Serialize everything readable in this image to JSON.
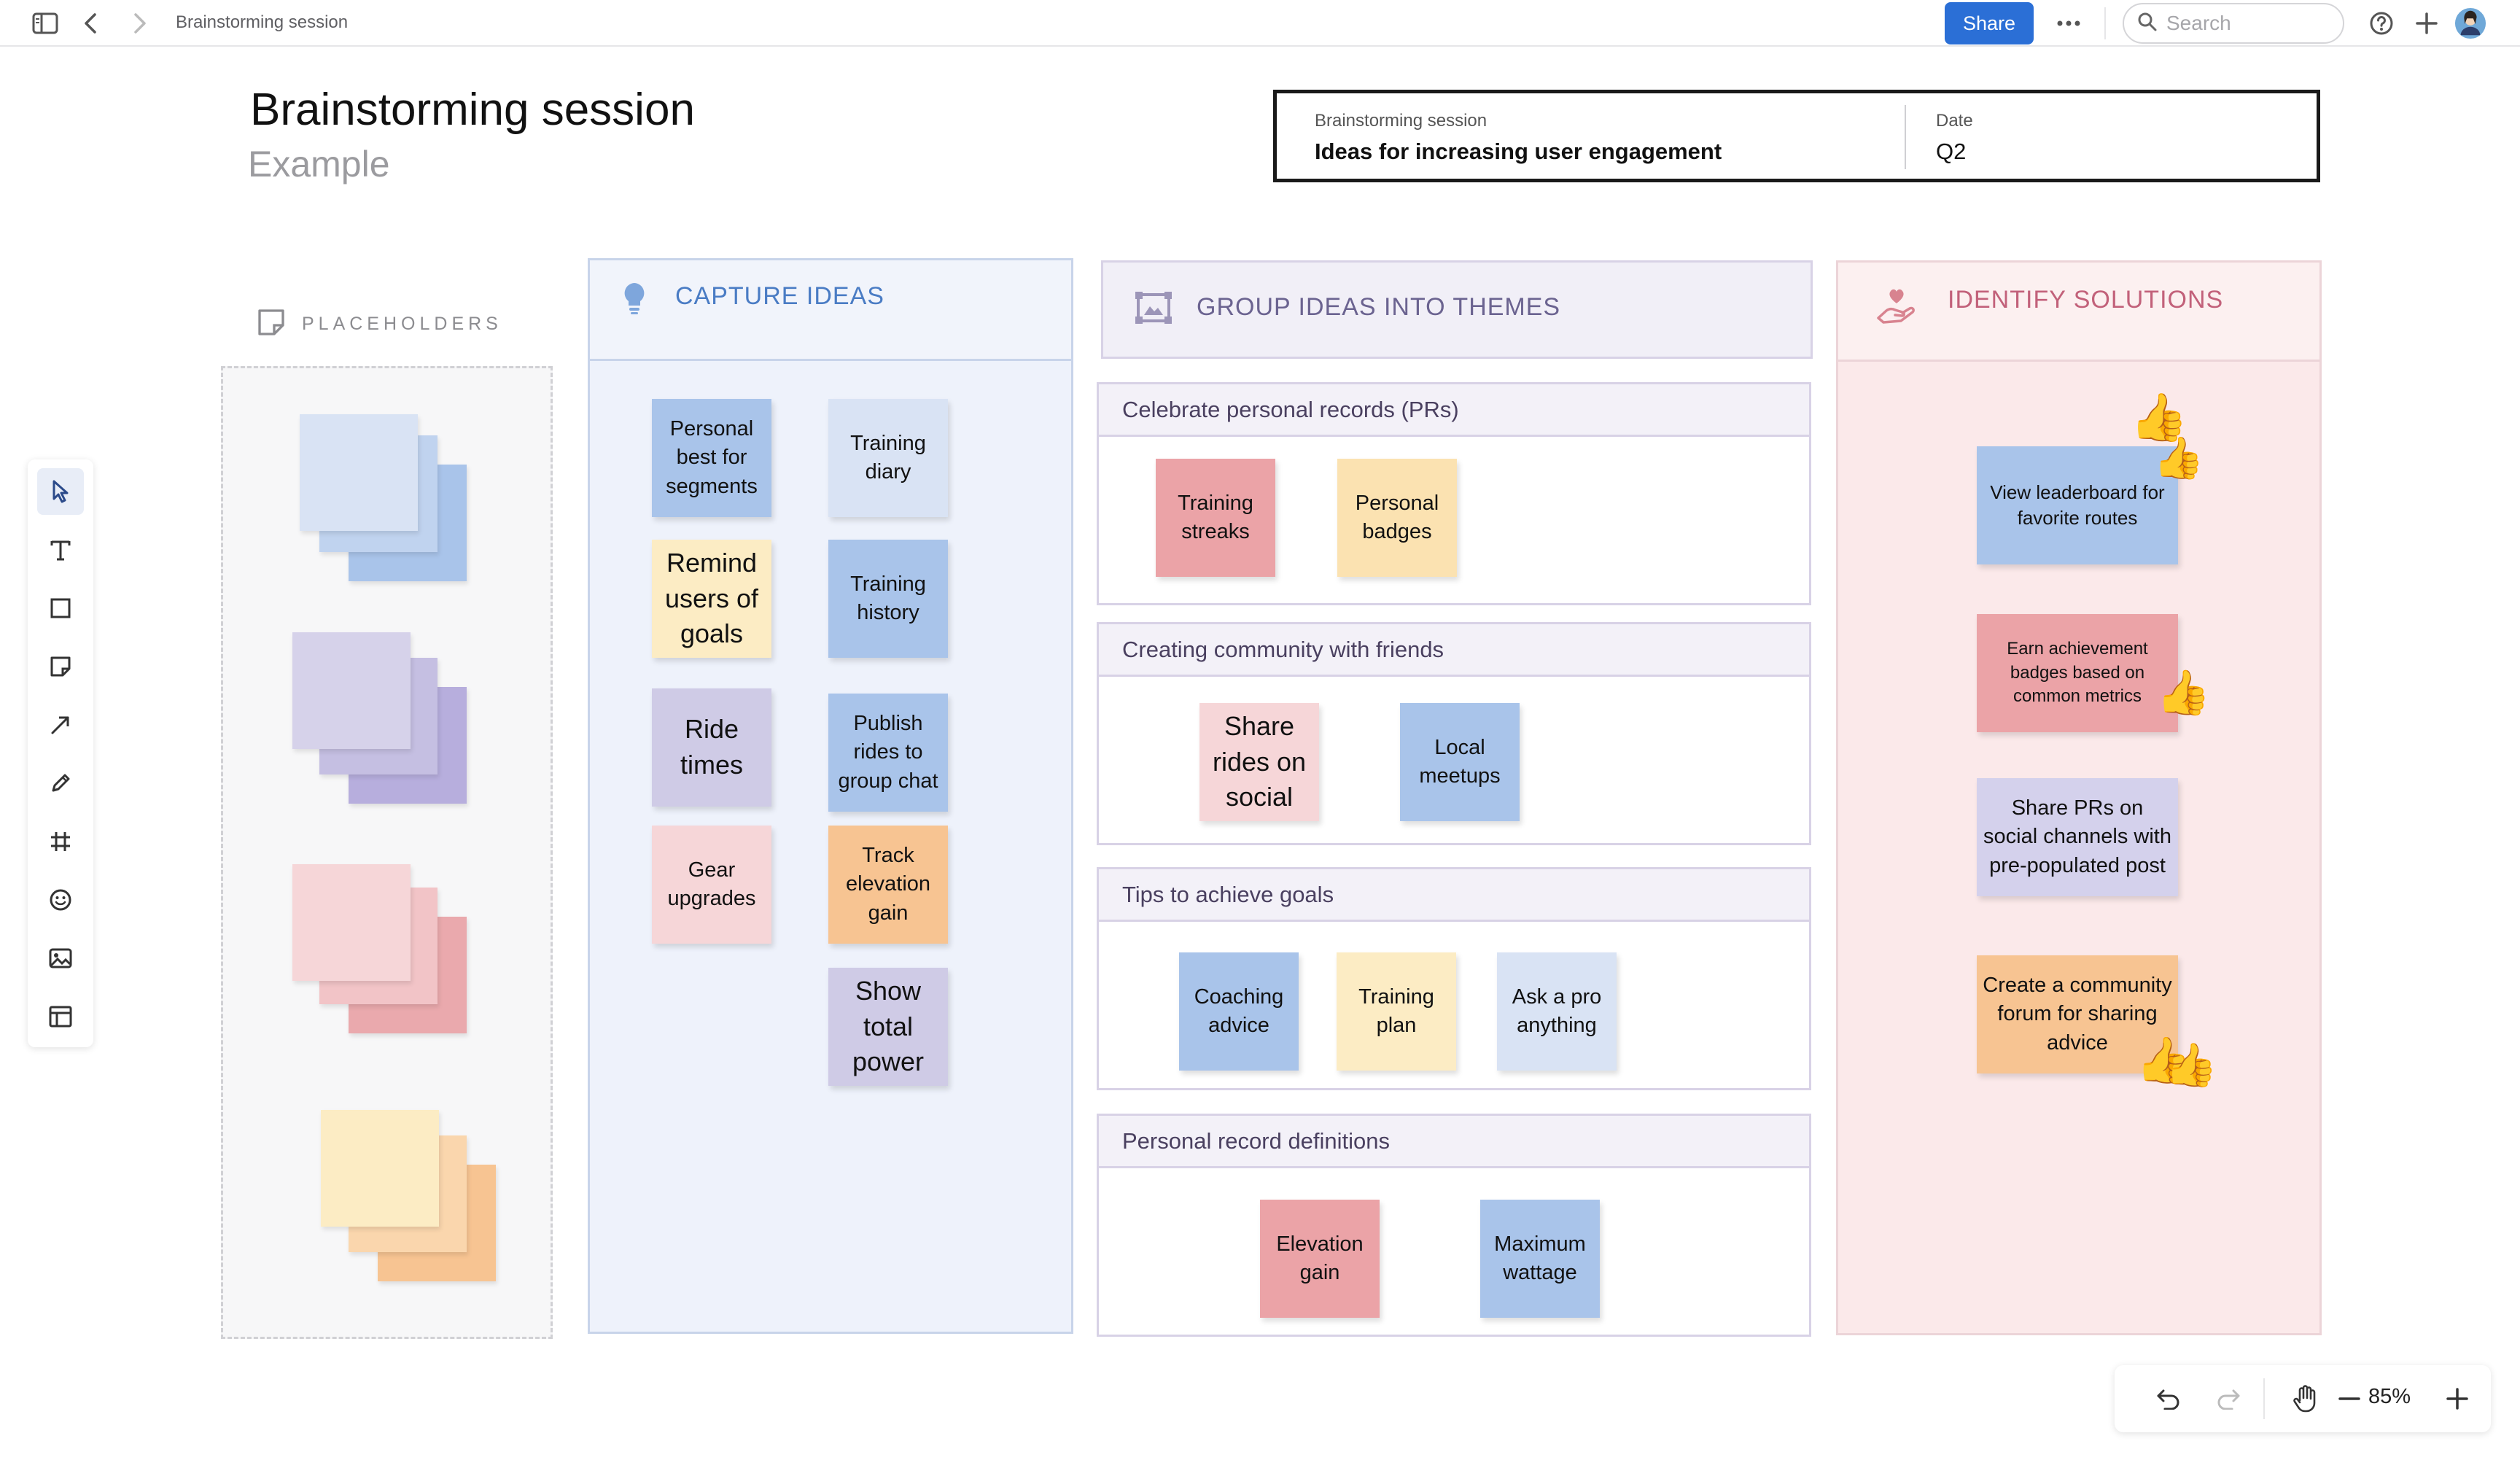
{
  "topbar": {
    "breadcrumb": "Brainstorming session",
    "share_label": "Share",
    "search_placeholder": "Search"
  },
  "board": {
    "title": "Brainstorming session",
    "subtitle": "Example"
  },
  "info_box": {
    "session_label": "Brainstorming session",
    "session_value": "Ideas for increasing user engagement",
    "date_label": "Date",
    "date_value": "Q2"
  },
  "placeholders": {
    "label": "PLACEHOLDERS"
  },
  "capture": {
    "title": "CAPTURE IDEAS",
    "stickies": [
      {
        "text": "Personal best for segments",
        "color": "#a9c4ea"
      },
      {
        "text": "Training diary",
        "color": "#d9e3f4"
      },
      {
        "text": "Remind users of goals",
        "color": "#fcecc4"
      },
      {
        "text": "Training history",
        "color": "#a9c4ea"
      },
      {
        "text": "Ride times",
        "color": "#cfcbe6"
      },
      {
        "text": "Publish rides to group chat",
        "color": "#a9c4ea"
      },
      {
        "text": "Gear upgrades",
        "color": "#f6d6d8"
      },
      {
        "text": "Track elevation gain",
        "color": "#f7c492"
      },
      {
        "text": "Show total power",
        "color": "#cfcbe6"
      }
    ]
  },
  "group": {
    "title": "GROUP IDEAS INTO THEMES",
    "themes": [
      {
        "label": "Celebrate personal records (PRs)",
        "stickies": [
          "Training streaks",
          "Personal badges"
        ]
      },
      {
        "label": "Creating community with friends",
        "stickies": [
          "Share rides on social",
          "Local meetups"
        ]
      },
      {
        "label": "Tips to achieve goals",
        "stickies": [
          "Coaching advice",
          "Training plan",
          "Ask a pro anything"
        ]
      },
      {
        "label": "Personal record definitions",
        "stickies": [
          "Elevation gain",
          "Maximum wattage"
        ]
      }
    ]
  },
  "identify": {
    "title": "IDENTIFY SOLUTIONS",
    "stickies": [
      "View leaderboard for favorite routes",
      "Earn achievement badges based on common metrics",
      "Share PRs on social channels with pre-populated post",
      "Create a community forum for sharing advice"
    ],
    "reaction": "👍"
  },
  "zoom": {
    "level": "85%"
  },
  "colors": {
    "accent": "#2b6fd6",
    "capture_title": "#4a7cc4",
    "group_title": "#6b6390",
    "identify_title": "#c2617a"
  }
}
